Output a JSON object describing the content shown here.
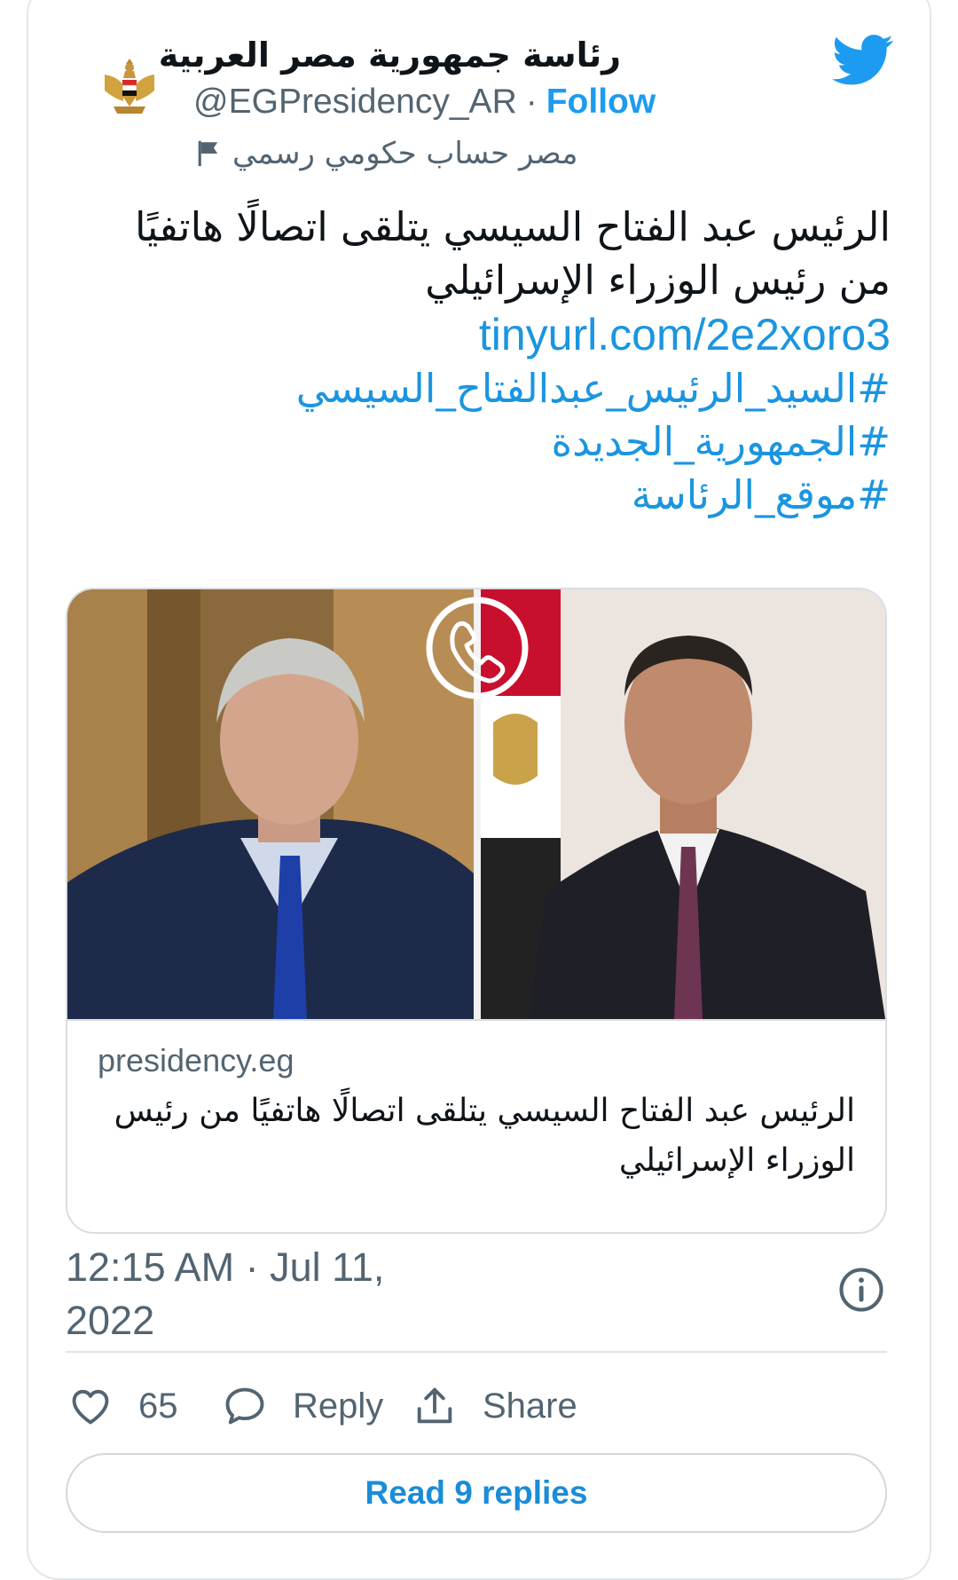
{
  "header": {
    "display_name": "رئاسة جمهورية مصر العربية",
    "handle": "@EGPresidency_AR",
    "separator": "·",
    "follow_label": "Follow",
    "account_label": "مصر حساب حكومي رسمي",
    "verified_icon": "verified-badge-icon",
    "brand_icon": "twitter-bird-icon",
    "avatar": "egypt-eagle-emblem"
  },
  "tweet": {
    "line1": "الرئيس عبد الفتاح السيسي يتلقى اتصالًا هاتفيًا",
    "line2": "من رئيس الوزراء الإسرائيلي",
    "link": "tinyurl.com/2e2xoro3",
    "hashtags": [
      "#السيد_الرئيس_عبدالفتاح_السيسي",
      "#الجمهورية_الجديدة",
      "#موقع_الرئاسة"
    ]
  },
  "link_card": {
    "domain": "presidency.eg",
    "title_line1": "الرئيس عبد الفتاح السيسي يتلقى اتصالًا هاتفيًا من رئيس",
    "title_line2": "الوزراء الإسرائيلي",
    "image": "two-portraits-with-phone-call-icon"
  },
  "meta": {
    "time_line1": "12:15 AM · Jul 11,",
    "time_line2": "2022",
    "info_icon": "info-icon"
  },
  "actions": {
    "like_count": "65",
    "reply_label": "Reply",
    "share_label": "Share"
  },
  "footer": {
    "read_replies_label": "Read 9 replies"
  },
  "colors": {
    "accent": "#1d9bf0",
    "link": "#1b95e0",
    "text": "#0f1419",
    "secondary": "#536471"
  }
}
